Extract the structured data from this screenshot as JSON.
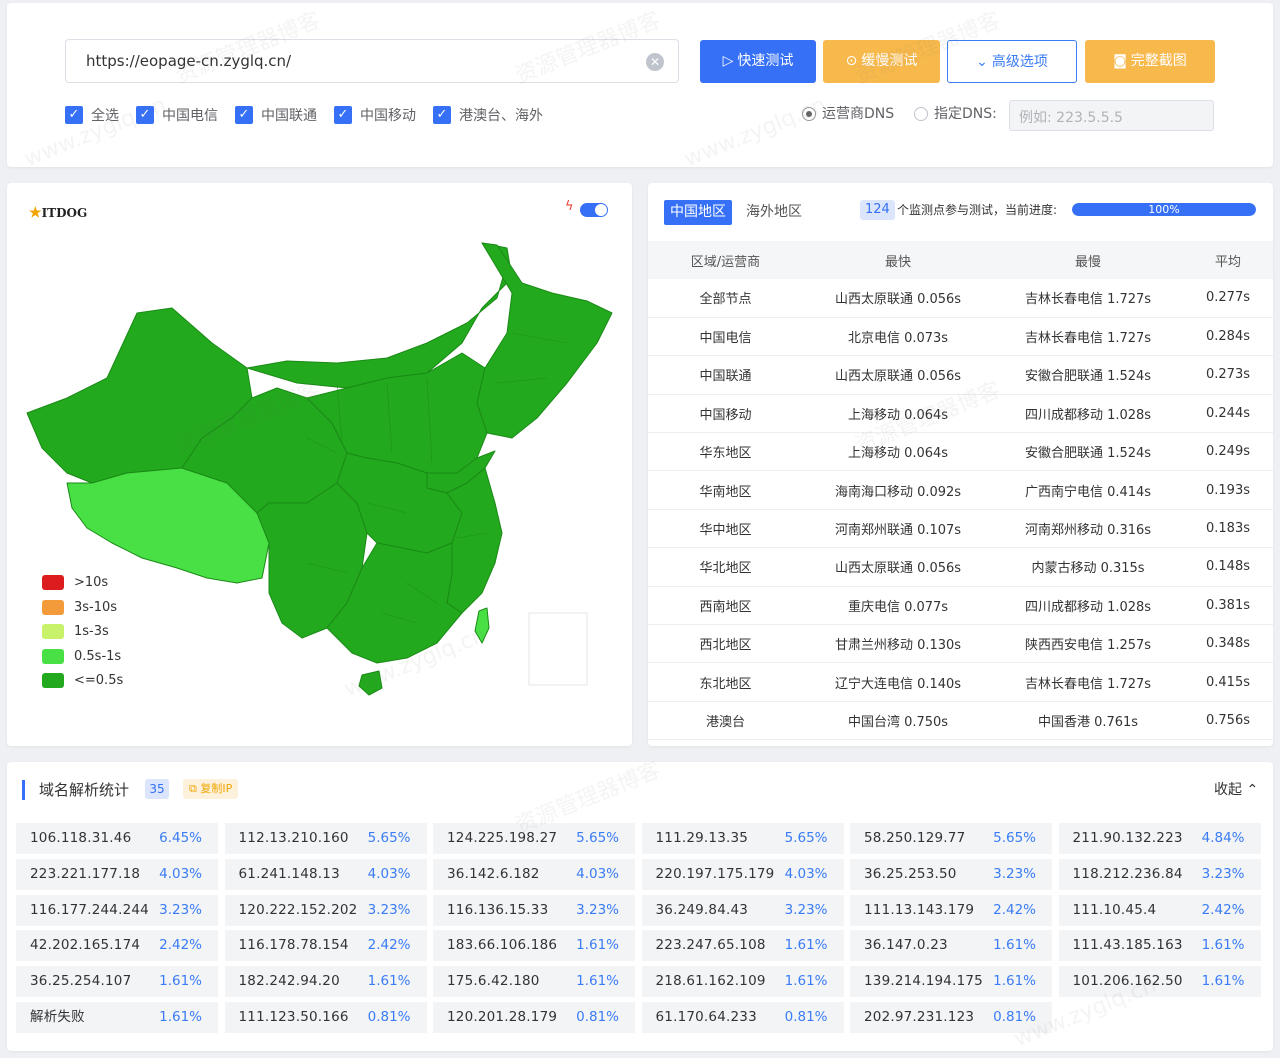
{
  "url_input": {
    "value": "https://eopage-cn.zyglq.cn/"
  },
  "buttons": {
    "fast": "快速测试",
    "slow": "缓慢测试",
    "advanced": "高级选项",
    "screenshot": "完整截图"
  },
  "filters": [
    "全选",
    "中国电信",
    "中国联通",
    "中国移动",
    "港澳台、海外"
  ],
  "dns": {
    "operator_label": "运营商DNS",
    "custom_label": "指定DNS:",
    "custom_placeholder": "例如: 223.5.5.5",
    "selected": "运营商DNS"
  },
  "map": {
    "logo_text": "ITDOG",
    "toggle_on": true,
    "legend": [
      {
        "label": ">10s",
        "color": "#dd1d1d"
      },
      {
        "label": "3s-10s",
        "color": "#f39a3a"
      },
      {
        "label": "1s-3s",
        "color": "#c7f26a"
      },
      {
        "label": "0.5s-1s",
        "color": "#49e045"
      },
      {
        "label": "<=0.5s",
        "color": "#22a91d"
      }
    ]
  },
  "stats": {
    "tabs": [
      "中国地区",
      "海外地区"
    ],
    "active_tab": "中国地区",
    "node_count": "124",
    "progress_text": "个监测点参与测试，当前进度:",
    "progress_label": "100%",
    "progress_value": 1.0,
    "headers": [
      "区域/运营商",
      "最快",
      "最慢",
      "平均"
    ],
    "rows": [
      [
        "全部节点",
        "山西太原联通 0.056s",
        "吉林长春电信 1.727s",
        "0.277s"
      ],
      [
        "中国电信",
        "北京电信 0.073s",
        "吉林长春电信 1.727s",
        "0.284s"
      ],
      [
        "中国联通",
        "山西太原联通 0.056s",
        "安徽合肥联通 1.524s",
        "0.273s"
      ],
      [
        "中国移动",
        "上海移动 0.064s",
        "四川成都移动 1.028s",
        "0.244s"
      ],
      [
        "华东地区",
        "上海移动 0.064s",
        "安徽合肥联通 1.524s",
        "0.249s"
      ],
      [
        "华南地区",
        "海南海口移动 0.092s",
        "广西南宁电信 0.414s",
        "0.193s"
      ],
      [
        "华中地区",
        "河南郑州联通 0.107s",
        "河南郑州移动 0.316s",
        "0.183s"
      ],
      [
        "华北地区",
        "山西太原联通 0.056s",
        "内蒙古移动 0.315s",
        "0.148s"
      ],
      [
        "西南地区",
        "重庆电信 0.077s",
        "四川成都移动 1.028s",
        "0.381s"
      ],
      [
        "西北地区",
        "甘肃兰州移动 0.130s",
        "陕西西安电信 1.257s",
        "0.348s"
      ],
      [
        "东北地区",
        "辽宁大连电信 0.140s",
        "吉林长春电信 1.727s",
        "0.415s"
      ],
      [
        "港澳台",
        "中国台湾 0.750s",
        "中国香港 0.761s",
        "0.756s"
      ]
    ]
  },
  "dns_stats": {
    "title": "域名解析统计",
    "count": "35",
    "copy_label": "复制IP",
    "collapse_label": "收起",
    "items": [
      [
        "106.118.31.46",
        "6.45%"
      ],
      [
        "112.13.210.160",
        "5.65%"
      ],
      [
        "124.225.198.27",
        "5.65%"
      ],
      [
        "111.29.13.35",
        "5.65%"
      ],
      [
        "58.250.129.77",
        "5.65%"
      ],
      [
        "211.90.132.223",
        "4.84%"
      ],
      [
        "223.221.177.18",
        "4.03%"
      ],
      [
        "61.241.148.13",
        "4.03%"
      ],
      [
        "36.142.6.182",
        "4.03%"
      ],
      [
        "220.197.175.179",
        "4.03%"
      ],
      [
        "36.25.253.50",
        "3.23%"
      ],
      [
        "118.212.236.84",
        "3.23%"
      ],
      [
        "116.177.244.244",
        "3.23%"
      ],
      [
        "120.222.152.202",
        "3.23%"
      ],
      [
        "116.136.15.33",
        "3.23%"
      ],
      [
        "36.249.84.43",
        "3.23%"
      ],
      [
        "111.13.143.179",
        "2.42%"
      ],
      [
        "111.10.45.4",
        "2.42%"
      ],
      [
        "42.202.165.174",
        "2.42%"
      ],
      [
        "116.178.78.154",
        "2.42%"
      ],
      [
        "183.66.106.186",
        "1.61%"
      ],
      [
        "223.247.65.108",
        "1.61%"
      ],
      [
        "36.147.0.23",
        "1.61%"
      ],
      [
        "111.43.185.163",
        "1.61%"
      ],
      [
        "36.25.254.107",
        "1.61%"
      ],
      [
        "182.242.94.20",
        "1.61%"
      ],
      [
        "175.6.42.180",
        "1.61%"
      ],
      [
        "218.61.162.109",
        "1.61%"
      ],
      [
        "139.214.194.175",
        "1.61%"
      ],
      [
        "101.206.162.50",
        "1.61%"
      ],
      [
        "解析失败",
        "1.61%"
      ],
      [
        "111.123.50.166",
        "0.81%"
      ],
      [
        "120.201.28.179",
        "0.81%"
      ],
      [
        "61.170.64.233",
        "0.81%"
      ],
      [
        "202.97.231.123",
        "0.81%"
      ]
    ]
  },
  "watermarks": [
    "资源管理器博客",
    "www.zyglq.cn"
  ]
}
